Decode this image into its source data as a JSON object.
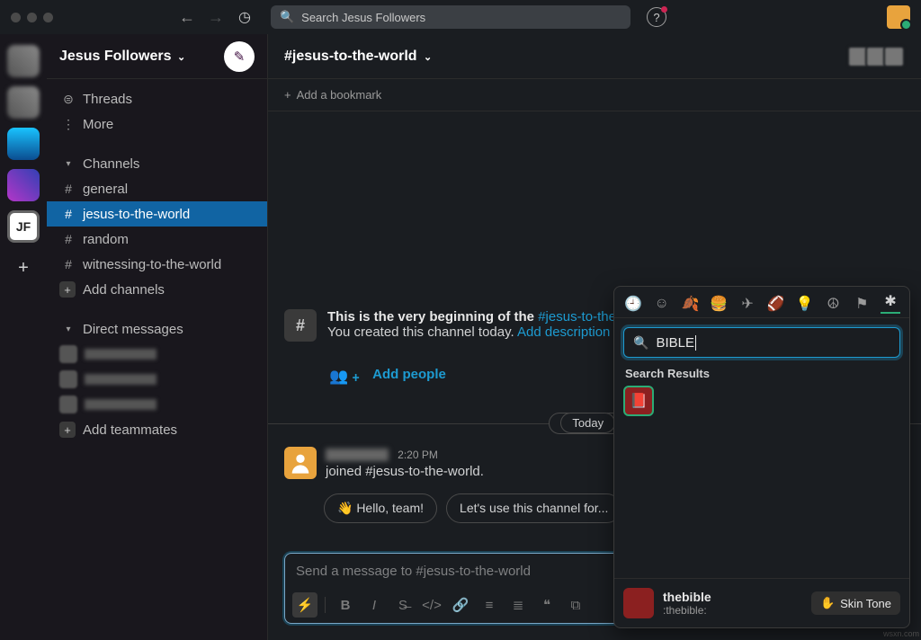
{
  "workspace": {
    "name": "Jesus Followers",
    "initials": "JF"
  },
  "search": {
    "placeholder": "Search Jesus Followers"
  },
  "sidebar": {
    "threads": "Threads",
    "more": "More",
    "channels_header": "Channels",
    "channels": [
      {
        "name": "general"
      },
      {
        "name": "jesus-to-the-world",
        "active": true
      },
      {
        "name": "random"
      },
      {
        "name": "witnessing-to-the-world"
      }
    ],
    "add_channels": "Add channels",
    "dm_header": "Direct messages",
    "add_teammates": "Add teammates"
  },
  "channel": {
    "name": "#jesus-to-the-world",
    "add_bookmark": "Add a bookmark",
    "intro_prefix": "This is the very beginning of the ",
    "intro_link": "#jesus-to-the-wo",
    "intro_line2": "You created this channel today. ",
    "intro_add_desc": "Add description",
    "add_people": "Add people",
    "divider": "Today",
    "message": {
      "time": "2:20 PM",
      "text": "joined #jesus-to-the-world."
    },
    "suggestions": [
      "👋 Hello, team!",
      "Let's use this channel for..."
    ],
    "composer_placeholder": "Send a message to #jesus-to-the-world"
  },
  "emoji": {
    "search_value": "BIBLE",
    "results_label": "Search Results",
    "footer_name": "thebible",
    "footer_short": ":thebible:",
    "skin_tone": "Skin Tone"
  },
  "watermark": "wsxn.com"
}
